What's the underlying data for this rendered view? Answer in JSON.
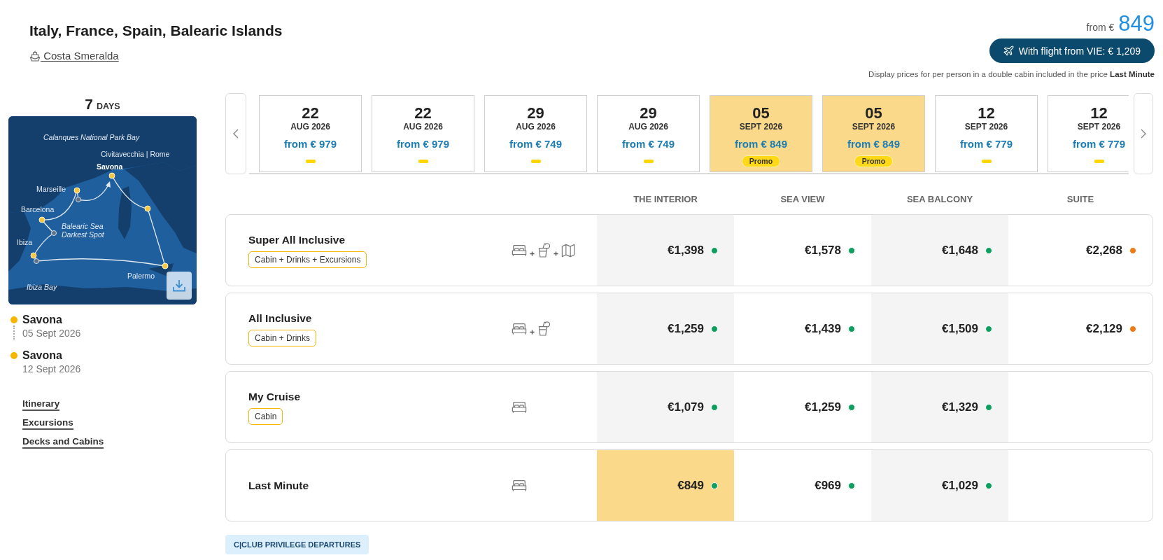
{
  "header": {
    "title": "Italy, France, Spain, Balearic Islands",
    "ship": "Costa Smeralda"
  },
  "pricing": {
    "from_label": "from €",
    "from_price": "849",
    "flight_button": "With flight from VIE: € 1,209",
    "note": "Display prices for per person in a double cabin included in the price **Last Minute**"
  },
  "cruise": {
    "duration": "7",
    "duration_unit": "DAYS",
    "map": {
      "labels": [
        {
          "text": "Calanques National Park Bay",
          "kind": "scenic"
        },
        {
          "text": "Civitavecchia | Rome",
          "kind": "port"
        },
        {
          "text": "Savona",
          "kind": "home"
        },
        {
          "text": "Marseille",
          "kind": "port"
        },
        {
          "text": "Barcelona",
          "kind": "port"
        },
        {
          "text": "Balearic Sea Darkest Spot",
          "kind": "scenic"
        },
        {
          "text": "Ibiza",
          "kind": "port"
        },
        {
          "text": "Palermo",
          "kind": "port"
        },
        {
          "text": "Ibiza Bay",
          "kind": "scenic"
        }
      ]
    },
    "stops": [
      {
        "port": "Savona",
        "date": "05 Sept 2026"
      },
      {
        "port": "Savona",
        "date": "12 Sept 2026"
      }
    ],
    "links": [
      "Itinerary",
      "Excursions",
      "Decks and Cabins"
    ]
  },
  "departures": [
    {
      "day": "22",
      "month": "AUG 2026",
      "price": "from € 979",
      "selected": false
    },
    {
      "day": "22",
      "month": "AUG 2026",
      "price": "from € 979",
      "selected": false
    },
    {
      "day": "29",
      "month": "AUG 2026",
      "price": "from € 749",
      "selected": false
    },
    {
      "day": "29",
      "month": "AUG 2026",
      "price": "from € 749",
      "selected": false
    },
    {
      "day": "05",
      "month": "SEPT 2026",
      "price": "from € 849",
      "badge": "Promo",
      "selected": true
    },
    {
      "day": "05",
      "month": "SEPT 2026",
      "price": "from € 849",
      "badge": "Promo",
      "selected": true
    },
    {
      "day": "12",
      "month": "SEPT 2026",
      "price": "from € 779",
      "selected": false
    },
    {
      "day": "12",
      "month": "SEPT 2026",
      "price": "from € 779",
      "selected": false
    }
  ],
  "table": {
    "columns": [
      "THE INTERIOR",
      "SEA VIEW",
      "SEA BALCONY",
      "SUITE"
    ],
    "rows": [
      {
        "name": "Super All Inclusive",
        "tag": "Cabin + Drinks + Excursions",
        "icons": [
          {
            "kind": "cabin"
          },
          {
            "kind": "drinks"
          },
          {
            "kind": "excursions"
          }
        ],
        "prices": [
          {
            "price": "€1,398",
            "color": "#0e9f5e",
            "selected": false
          },
          {
            "price": "€1,578",
            "color": "#0e9f5e",
            "selected": false
          },
          {
            "price": "€1,648",
            "color": "#0e9f5e",
            "selected": false
          },
          {
            "price": "€2,268",
            "color": "#f07a14",
            "selected": false
          }
        ]
      },
      {
        "name": "All Inclusive",
        "tag": "Cabin + Drinks",
        "icons": [
          {
            "kind": "cabin"
          },
          {
            "kind": "drinks"
          }
        ],
        "prices": [
          {
            "price": "€1,259",
            "color": "#0e9f5e",
            "selected": false
          },
          {
            "price": "€1,439",
            "color": "#0e9f5e",
            "selected": false
          },
          {
            "price": "€1,509",
            "color": "#0e9f5e",
            "selected": false
          },
          {
            "price": "€2,129",
            "color": "#f07a14",
            "selected": false
          }
        ]
      },
      {
        "name": "My Cruise",
        "tag": "Cabin",
        "icons": [
          {
            "kind": "cabin"
          }
        ],
        "prices": [
          {
            "price": "€1,079",
            "color": "#0e9f5e",
            "selected": false
          },
          {
            "price": "€1,259",
            "color": "#0e9f5e",
            "selected": false
          },
          {
            "price": "€1,329",
            "color": "#0e9f5e",
            "selected": false
          }
        ]
      },
      {
        "name": "Last Minute",
        "icons": [
          {
            "kind": "cabin"
          }
        ],
        "prices": [
          {
            "price": "€849",
            "color": "#0e9f5e",
            "selected": true
          },
          {
            "price": "€969",
            "color": "#0e9f5e",
            "selected": false
          },
          {
            "price": "€1,029",
            "color": "#0e9f5e",
            "selected": false
          }
        ]
      }
    ]
  },
  "club_badge": "C|CLUB PRIVILEGE DEPARTURES"
}
